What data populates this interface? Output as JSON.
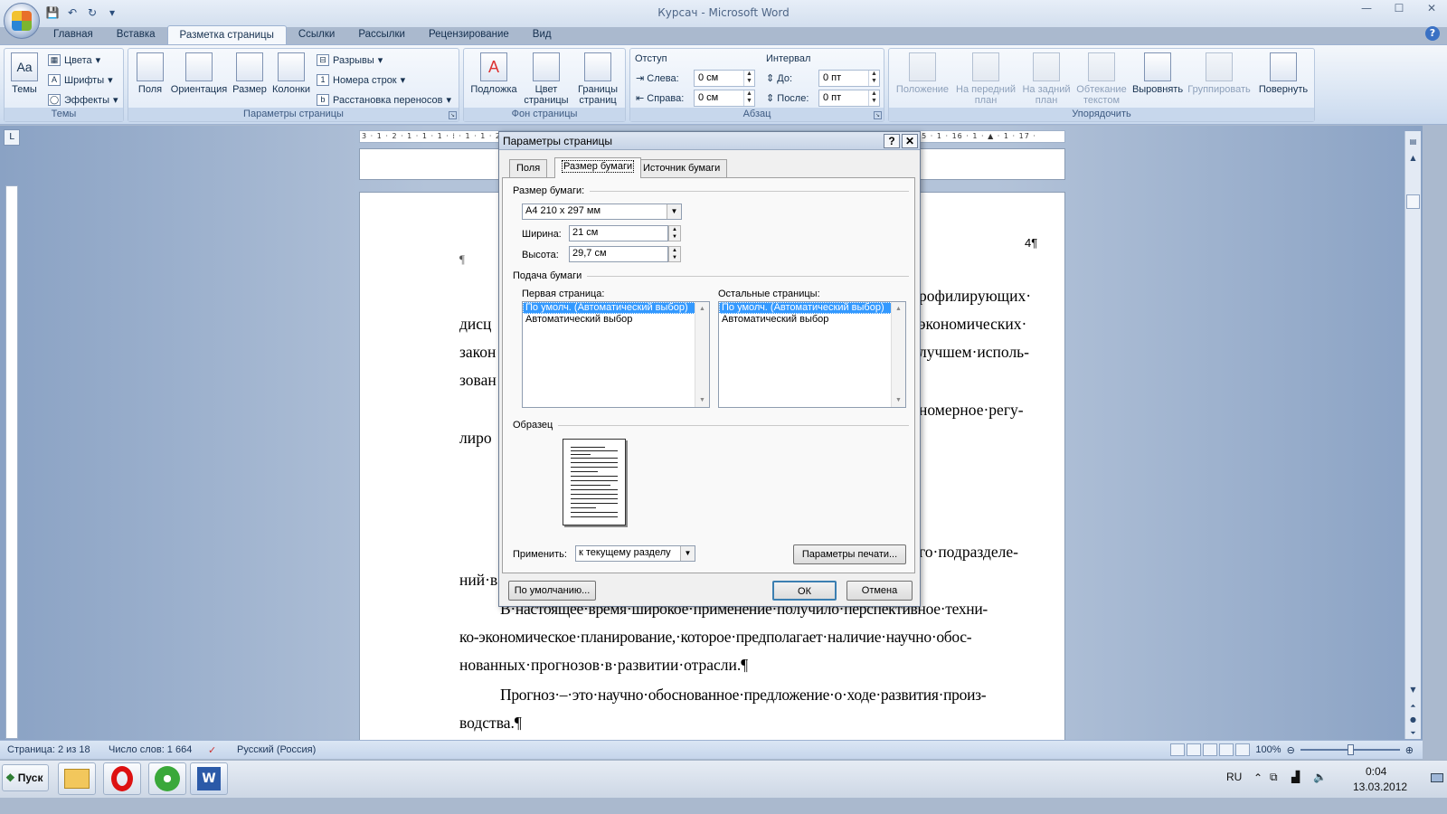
{
  "app": {
    "title": "Курсач - Microsoft Word",
    "tabs": [
      "Главная",
      "Вставка",
      "Разметка страницы",
      "Ссылки",
      "Рассылки",
      "Рецензирование",
      "Вид"
    ],
    "active_tab": "Разметка страницы"
  },
  "ribbon": {
    "themes": {
      "title": "Темы",
      "big": "Темы",
      "colors": "Цвета",
      "fonts": "Шрифты",
      "effects": "Эффекты"
    },
    "page_setup": {
      "title": "Параметры страницы",
      "margins": "Поля",
      "orientation": "Ориентация",
      "size": "Размер",
      "columns": "Колонки",
      "breaks": "Разрывы",
      "line_numbers": "Номера строк",
      "hyphenation": "Расстановка переносов"
    },
    "page_background": {
      "title": "Фон страницы",
      "watermark": "Подложка",
      "page_color_1": "Цвет",
      "page_color_2": "страницы",
      "borders_1": "Границы",
      "borders_2": "страниц"
    },
    "paragraph": {
      "title": "Абзац",
      "indent": "Отступ",
      "left": "Слева:",
      "left_val": "0 см",
      "right": "Справа:",
      "right_val": "0 см",
      "spacing": "Интервал",
      "before": "До:",
      "before_val": "0 пт",
      "after": "После:",
      "after_val": "0 пт"
    },
    "arrange": {
      "title": "Упорядочить",
      "position": "Положение",
      "bring_front_1": "На передний",
      "bring_front_2": "план",
      "send_back_1": "На задний",
      "send_back_2": "план",
      "wrap_1": "Обтекание",
      "wrap_2": "текстом",
      "align": "Выровнять",
      "group": "Группировать",
      "rotate": "Повернуть"
    }
  },
  "ruler": {
    "text": "3 · 1 · 2 · 1 · 1 · 1 · ⁞ · 1 · 1 · 2 · 1 · 3 · 1 · 4 · 1 · 5 · 1 · 6 · 1 · 7 · 1 · 8 · 1 · 9 · 1 · 10 · 1 · 11 · 1 · 12 · 1 · 13 · 1 · 14 · 1 · 15 · 1 · 16 · 1 · ▲ · 1 · 17 ·"
  },
  "document": {
    "page_number": "4¶",
    "para_mark": "¶",
    "lines": [
      "рофилирующих·",
      "дисц",
      "экономических·",
      "закон",
      "лучшем·исполь-",
      "зован",
      "номерное·регу-",
      "лиро",
      "го·подразделе-",
      "ний·в",
      "В·настоящее·время·широкое·применение·получило·перспективное·техни-",
      "ко-экономическое·планирование,·которое·предполагает·наличие·научно·обос-",
      "нованных·прогнозов·в·развитии·отрасли.¶",
      "Прогноз·–·это·научно·обоснованное·предложение·о·ходе·развития·произ-",
      "водства.¶"
    ]
  },
  "dialog": {
    "title": "Параметры страницы",
    "help": "?",
    "close": "✕",
    "tabs": [
      "Поля",
      "Размер бумаги",
      "Источник бумаги"
    ],
    "active_tab": "Размер бумаги",
    "paper_size_label": "Размер бумаги:",
    "paper_size_value": "A4 210 x 297 мм",
    "width_label": "Ширина:",
    "width_value": "21 см",
    "height_label": "Высота:",
    "height_value": "29,7 см",
    "paper_source_label": "Подача бумаги",
    "first_page_label": "Первая страница:",
    "other_pages_label": "Остальные страницы:",
    "first_page_items": [
      "По умолч. (Автоматический выбор)",
      "Автоматический выбор"
    ],
    "other_pages_items": [
      "По умолч. (Автоматический выбор)",
      "Автоматический выбор"
    ],
    "preview_label": "Образец",
    "apply_label": "Применить:",
    "apply_value": "к текущему разделу",
    "print_options": "Параметры печати...",
    "default_button": "По умолчанию...",
    "ok": "ОК",
    "cancel": "Отмена"
  },
  "statusbar": {
    "page": "Страница: 2 из 18",
    "words": "Число слов: 1 664",
    "language": "Русский (Россия)",
    "zoom": "100%"
  },
  "taskbar": {
    "start": "Пуск",
    "lang": "RU",
    "time": "0:04",
    "date": "13.03.2012"
  },
  "colors": {
    "accent": "#3399ff",
    "ribbon": "#dbe6f4",
    "titlebar": "#d3dfee"
  }
}
